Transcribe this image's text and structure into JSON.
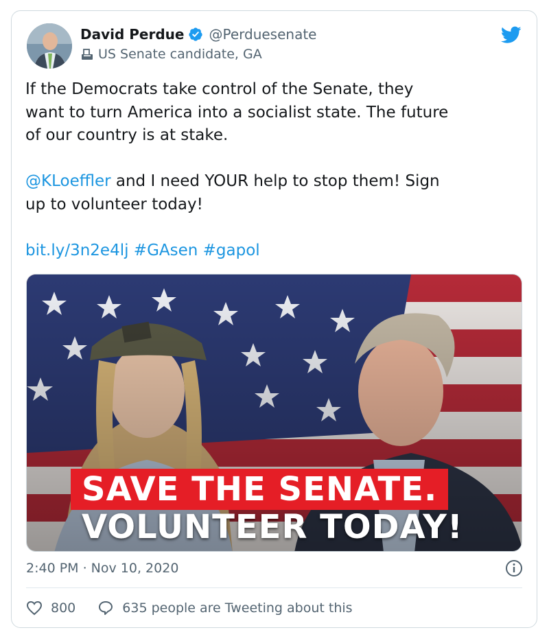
{
  "tweet": {
    "author": {
      "display_name": "David Perdue",
      "handle": "@Perduesenate",
      "label": "US Senate candidate, GA"
    },
    "text": {
      "para1_lines": [
        "If the Democrats take control of the Senate, they",
        "want to turn America into a socialist state. The future",
        "of our country is at stake."
      ],
      "mention": "@KLoeffler",
      "para2_line1_rest": " and I need YOUR help to stop them! Sign",
      "para2_line2": "up to volunteer today!",
      "url": "bit.ly/3n2e4lj",
      "hashtag1": "#GAsen",
      "hashtag2": "#gapol"
    },
    "media": {
      "banner_line1": "SAVE THE SENATE.",
      "banner_line2": "VOLUNTEER TODAY!"
    },
    "timestamp": "2:40 PM · Nov 10, 2020",
    "likes": "800",
    "replies_label": "635 people are Tweeting about this"
  },
  "colors": {
    "link": "#1b95e0",
    "twitter_blue": "#1d9bf0",
    "muted": "#536471",
    "banner_red": "#e51e26"
  },
  "icons": [
    "verified-badge-icon",
    "ballot-box-icon",
    "twitter-bird-icon",
    "info-icon",
    "heart-icon",
    "reply-icon"
  ]
}
